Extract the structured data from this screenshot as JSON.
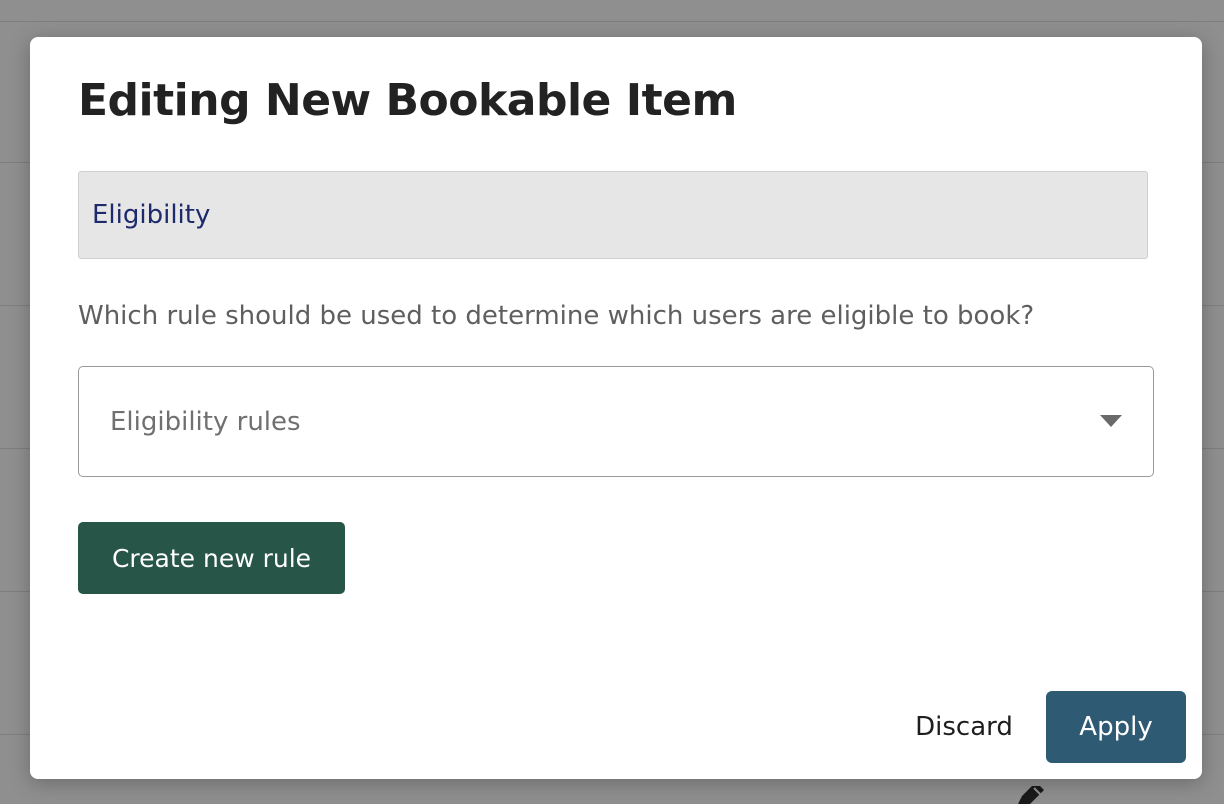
{
  "modal": {
    "title": "Editing New Bookable Item",
    "section_label": "Eligibility",
    "question": "Which rule should be used to determine which users are eligible to book?",
    "select": {
      "placeholder": "Eligibility rules",
      "icon": "chevron-down-icon"
    },
    "create_rule_label": "Create new rule",
    "discard_label": "Discard",
    "apply_label": "Apply"
  },
  "background": {
    "icon": "pencil-icon"
  },
  "colors": {
    "primary_green": "#275547",
    "apply_blue": "#2e5a73",
    "section_text": "#1d2a6b",
    "backdrop": "#8f8f8f"
  }
}
